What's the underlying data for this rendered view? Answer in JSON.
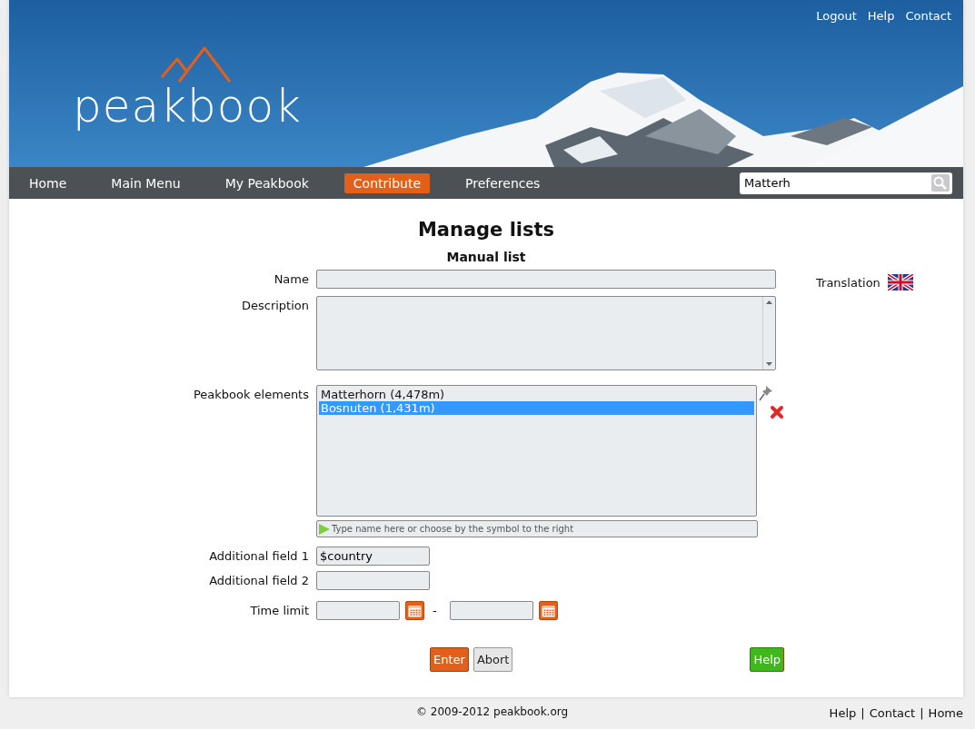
{
  "header": {
    "links": [
      "Logout",
      "Help",
      "Contact"
    ],
    "logo": "peakbook"
  },
  "nav": {
    "items": [
      {
        "label": "Home",
        "selected": false
      },
      {
        "label": "Main Menu",
        "selected": false
      },
      {
        "label": "My Peakbook",
        "selected": false
      },
      {
        "label": "Contribute",
        "selected": true
      },
      {
        "label": "Preferences",
        "selected": false
      }
    ],
    "search": {
      "value": "Matterh"
    }
  },
  "page": {
    "title": "Manage lists",
    "subtitle": "Manual list"
  },
  "name": {
    "label": "Name"
  },
  "translation": {
    "label": "Translation"
  },
  "description": {
    "label": "Description"
  },
  "elements": {
    "label": "Peakbook elements",
    "items": [
      {
        "text": "Matterhorn (4,478m)",
        "selected": false
      },
      {
        "text": "Bosnuten (1,431m)",
        "selected": true
      }
    ],
    "placeholder": "Type name here or choose by the symbol to the right"
  },
  "additional_fields": [
    {
      "label": "Additional field 1",
      "value": "$country"
    },
    {
      "label": "Additional field 2"
    }
  ],
  "time_limit": {
    "label": "Time limit",
    "separator": "-"
  },
  "buttons": [
    {
      "label": "Enter",
      "kind": "primary"
    },
    {
      "label": "Abort",
      "kind": "secondary"
    },
    {
      "label": "Help",
      "kind": "help"
    }
  ],
  "footer": {
    "copyright": "© 2009-2012 peakbook.org",
    "links": [
      "Help",
      "Contact",
      "Home"
    ],
    "separators": [
      "|",
      "|"
    ]
  }
}
